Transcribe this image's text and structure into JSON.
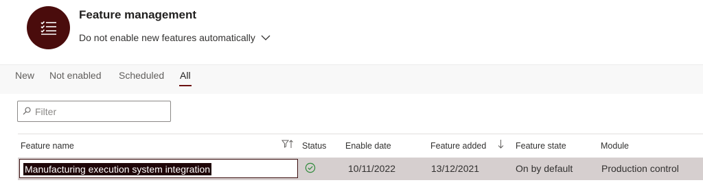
{
  "header": {
    "title": "Feature management",
    "subtitle": "Do not enable new features automatically",
    "app_icon": "list-icon",
    "accent_color": "#4a0c0c"
  },
  "tabs": [
    {
      "label": "New"
    },
    {
      "label": "Not enabled"
    },
    {
      "label": "Scheduled"
    },
    {
      "label": "All",
      "active": true
    }
  ],
  "filter": {
    "placeholder": "Filter",
    "value": ""
  },
  "grid": {
    "columns": {
      "feature_name": "Feature name",
      "status": "Status",
      "enable_date": "Enable date",
      "feature_added": "Feature added",
      "feature_state": "Feature state",
      "module": "Module"
    },
    "sort": {
      "column": "feature_added",
      "direction": "descending"
    },
    "rows": [
      {
        "feature_name": "Manufacturing execution system integration",
        "status": "enabled",
        "enable_date": "10/11/2022",
        "feature_added": "13/12/2021",
        "feature_state": "On by default",
        "module": "Production control",
        "selected": true
      }
    ]
  }
}
